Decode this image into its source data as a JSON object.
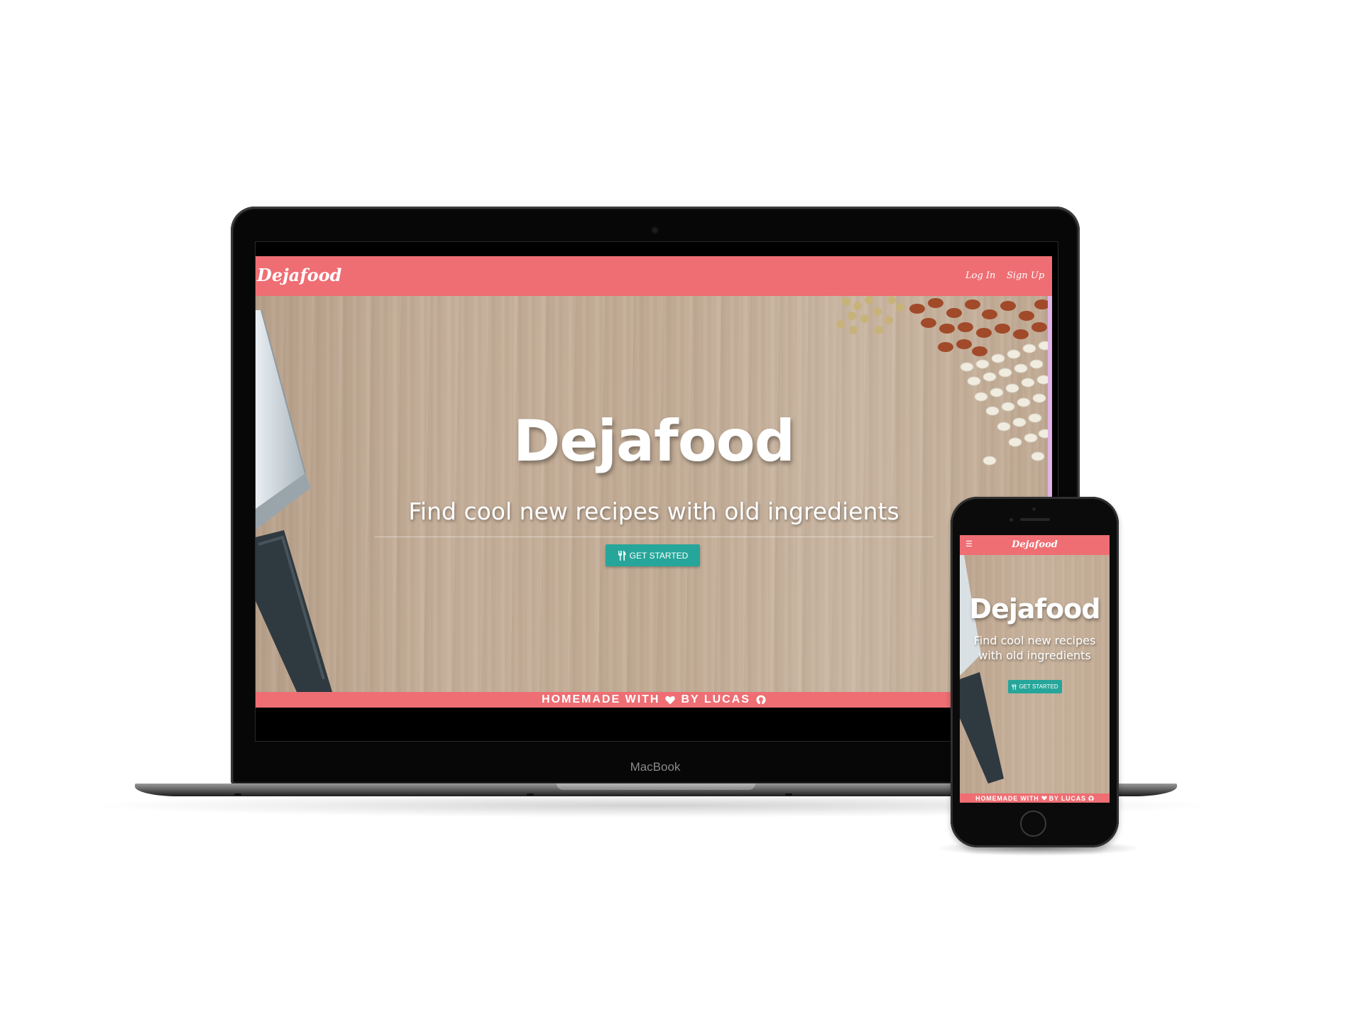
{
  "desktop": {
    "nav": {
      "brand": "Dejafood",
      "login": "Log In",
      "signup": "Sign Up"
    },
    "hero": {
      "title": "Dejafood",
      "subtitle": "Find cool new recipes with old ingredients",
      "cta": "GET STARTED"
    },
    "footer": {
      "text_before": "HOMEMADE WITH",
      "text_after": "BY LUCAS"
    }
  },
  "laptop_label": "MacBook",
  "mobile": {
    "nav": {
      "brand": "Dejafood"
    },
    "hero": {
      "title": "Dejafood",
      "subtitle": "Find cool new recipes with old ingredients",
      "cta": "GET STARTED"
    },
    "footer": {
      "text_before": "HOMEMADE WITH",
      "text_after": "BY LUCAS"
    }
  },
  "icons": {
    "cta_icon": "cutlery-icon",
    "footer_heart": "heart-icon",
    "footer_github": "github-icon",
    "mobile_menu": "hamburger-menu-icon"
  },
  "colors": {
    "brand_red": "#ee6e73",
    "teal_button": "#26a69a",
    "wood": "#c3ad97"
  }
}
